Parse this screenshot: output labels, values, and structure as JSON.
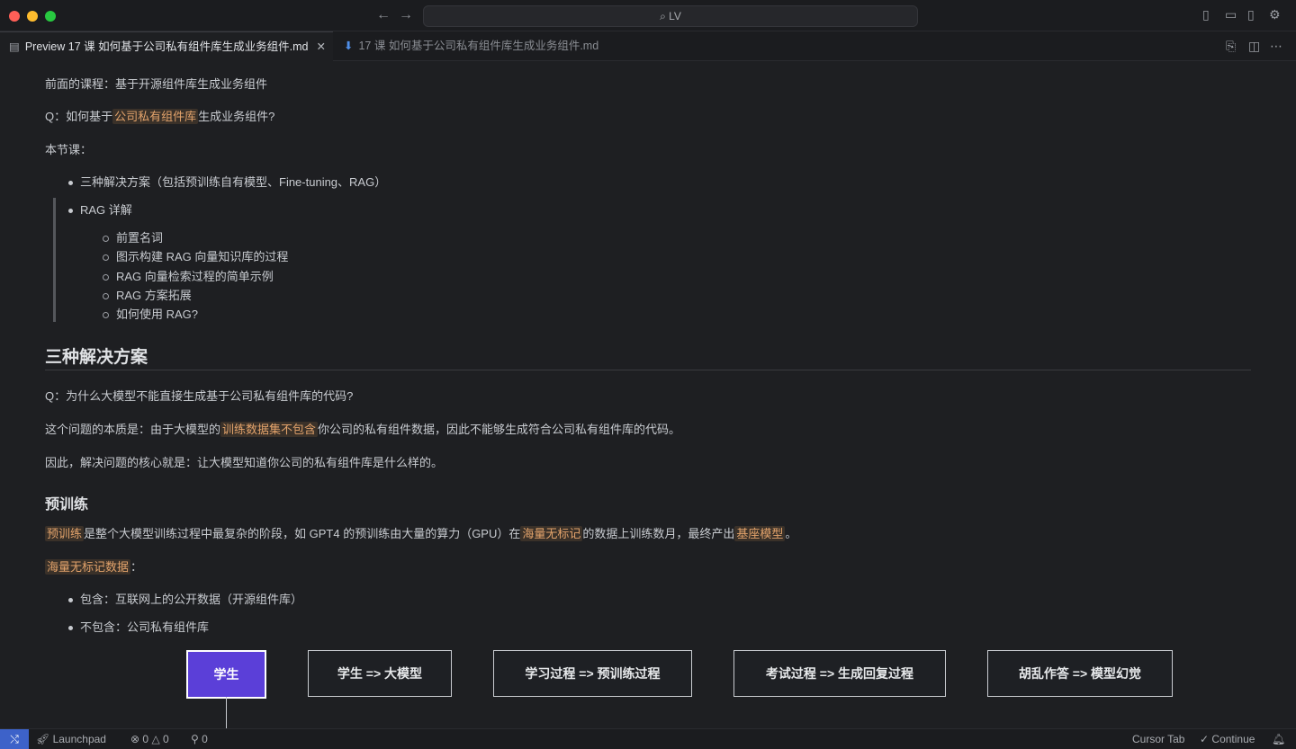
{
  "window": {
    "search_text": "LV",
    "nav_back_icon": "←",
    "nav_forward_icon": "→"
  },
  "tabs": [
    {
      "label": "Preview 17 课 如何基于公司私有组件库生成业务组件.md",
      "active": true
    },
    {
      "label": "17 课 如何基于公司私有组件库生成业务组件.md",
      "active": false
    }
  ],
  "doc": {
    "intro": "前面的课程：基于开源组件库生成业务组件",
    "q1_prefix": "Q：如何基于",
    "q1_hl": "公司私有组件库",
    "q1_suffix": "生成业务组件?",
    "section_label": "本节课：",
    "bullets": [
      "三种解决方案（包括预训练自有模型、Fine-tuning、RAG）",
      "RAG 详解"
    ],
    "sub_bullets": [
      "前置名词",
      "图示构建 RAG 向量知识库的过程",
      "RAG 向量检索过程的简单示例",
      "RAG 方案拓展",
      "如何使用 RAG?"
    ],
    "h2": "三种解决方案",
    "q2": "Q：为什么大模型不能直接生成基于公司私有组件库的代码?",
    "essence_prefix": "这个问题的本质是：由于大模型的",
    "essence_hl": "训练数据集不包含",
    "essence_suffix": "你公司的私有组件数据，因此不能够生成符合公司私有组件库的代码。",
    "core": "因此，解决问题的核心就是：让大模型知道你公司的私有组件库是什么样的。",
    "h3": "预训练",
    "pt_hl1": "预训练",
    "pt_text1": "是整个大模型训练过程中最复杂的阶段，如 GPT4 的预训练由大量的算力（GPU）在",
    "pt_hl2": "海量无标记",
    "pt_text2": "的数据上训练数月，最终产出",
    "pt_hl3": "基座模型",
    "pt_text3": "。",
    "data_hl": "海量无标记数据",
    "data_colon": "：",
    "data_bullets": [
      "包含：互联网上的公开数据（开源组件库）",
      "不包含：公司私有组件库"
    ]
  },
  "diagram": {
    "nodes": [
      "学生",
      "学生 => 大模型",
      "学习过程 => 预训练过程",
      "考试过程 => 生成回复过程",
      "胡乱作答 => 模型幻觉"
    ],
    "primary_color": "#5b3fd8"
  },
  "statusbar": {
    "launchpad": "Launchpad",
    "errors": "0",
    "warnings": "0",
    "ports": "0",
    "cursor_tab": "Cursor Tab",
    "continue": "Continue"
  }
}
